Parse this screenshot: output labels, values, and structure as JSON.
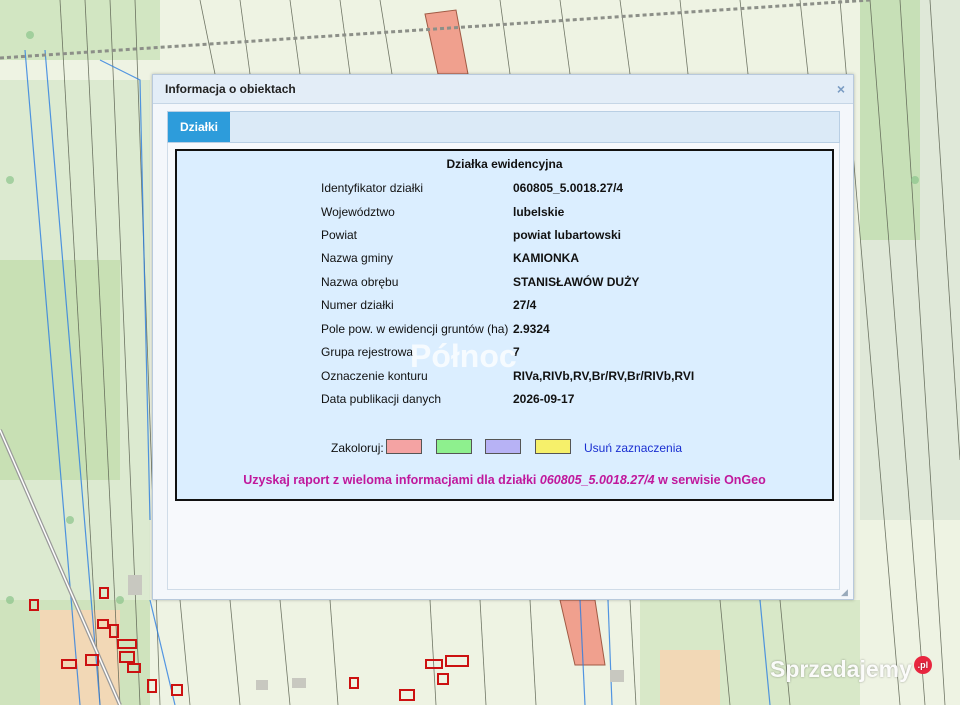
{
  "dialog": {
    "title": "Informacja o obiektach",
    "close_label": "×"
  },
  "tabs": [
    {
      "label": "Działki",
      "active": true
    }
  ],
  "parcel": {
    "heading": "Działka ewidencyjna",
    "rows": [
      {
        "key": "Identyfikator działki",
        "value": "060805_5.0018.27/4"
      },
      {
        "key": "Województwo",
        "value": "lubelskie"
      },
      {
        "key": "Powiat",
        "value": "powiat lubartowski"
      },
      {
        "key": "Nazwa gminy",
        "value": "KAMIONKA"
      },
      {
        "key": "Nazwa obrębu",
        "value": "STANISŁAWÓW DUŻY"
      },
      {
        "key": "Numer działki",
        "value": "27/4"
      },
      {
        "key": "Pole pow. w ewidencji gruntów (ha)",
        "value": "2.9324"
      },
      {
        "key": "Grupa rejestrowa",
        "value": "7"
      },
      {
        "key": "Oznaczenie konturu",
        "value": "RIVa,RIVb,RV,Br/RV,Br/RIVb,RVI"
      },
      {
        "key": "Data publikacji danych",
        "value": "2026-09-17"
      }
    ]
  },
  "colorize": {
    "label": "Zakoloruj:",
    "swatches": [
      "#f4a3a3",
      "#8ef08e",
      "#b7b2f5",
      "#f6f06a"
    ],
    "clear_label": "Usuń zaznaczenia"
  },
  "report": {
    "prefix": "Uzyskaj raport z wieloma informacjami dla działki",
    "parcel_id": "060805_5.0018.27/4",
    "suffix": "w serwisie OnGeo",
    "color": "#c0189c"
  },
  "watermark": {
    "text": "Północ"
  },
  "brand_logo": {
    "text": "Sprzedajemy",
    "badge": ".pl"
  },
  "colors": {
    "map_background": "#e9f0dd",
    "parcel_line": "#4a4f3c",
    "boundary_blue": "#2a7de1",
    "highlight_parcel": "#f0a08e",
    "tab_active": "#2d9cdb",
    "building_outline": "#cc1111"
  }
}
